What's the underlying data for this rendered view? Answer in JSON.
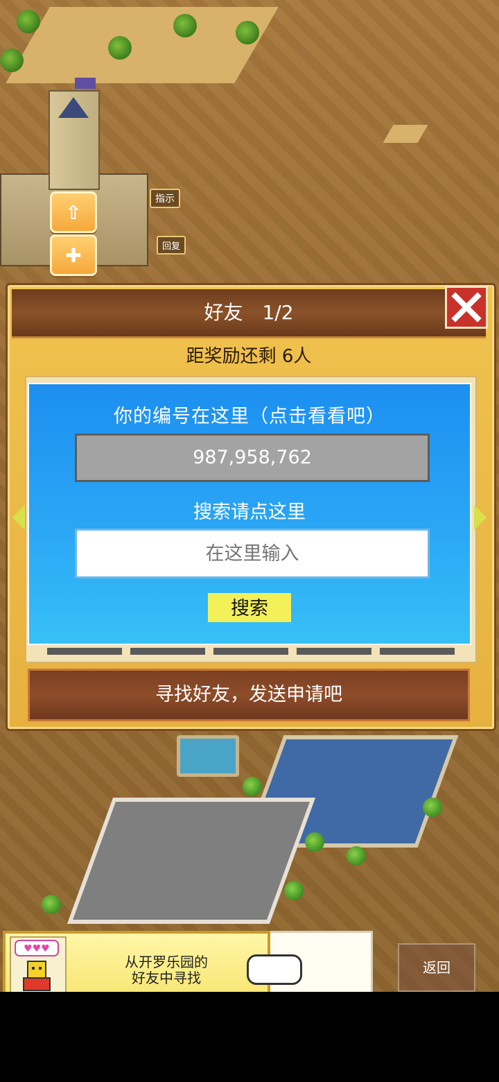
{
  "map": {
    "sign_hint": "指示",
    "sign_return": "回复"
  },
  "dialog": {
    "title": "好友　1/2",
    "reward_text": "距奖励还剩 6人",
    "id_prompt": "你的编号在这里（点击看看吧）",
    "user_id": "987,958,762",
    "search_prompt": "搜索请点这里",
    "search_placeholder": "在这里输入",
    "search_button": "搜索",
    "find_friends_button": "寻找好友，发送申请吧"
  },
  "bottom": {
    "banner_line1": "从开罗乐园的",
    "banner_line2": "好友中寻找",
    "back_button": "返回"
  },
  "colors": {
    "accent_blue": "#1c8ff0",
    "dialog_gold": "#f0c24e",
    "header_brown": "#6e3d1e",
    "close_red": "#c9322a",
    "search_yellow": "#f3f05a"
  }
}
